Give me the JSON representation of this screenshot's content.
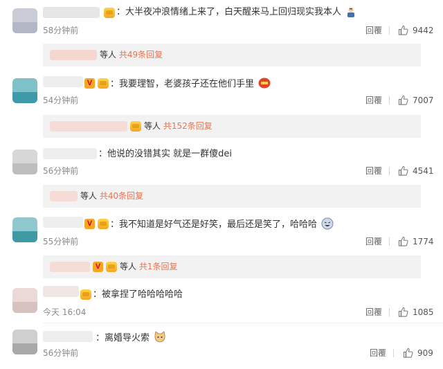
{
  "comments": [
    {
      "text": "大半夜冲浪情绪上来了，白天醒来马上回归现实我本人",
      "time": "58分钟前",
      "reply_label": "回覆",
      "likes": "9442",
      "sub_prefix": "等人",
      "sub_count": "共49条回复",
      "emoji": "person-facepalm-icon"
    },
    {
      "text": "我要理智，老婆孩子还在他们手里",
      "time": "54分钟前",
      "reply_label": "回覆",
      "likes": "7007",
      "sub_prefix": "等人",
      "sub_count": "共152条回复",
      "emoji": "red-envelope-icon"
    },
    {
      "text": "他说的没错其实 就是一群傻dei",
      "time": "56分钟前",
      "reply_label": "回覆",
      "likes": "4541",
      "sub_prefix": "等人",
      "sub_count": "共40条回复"
    },
    {
      "text": "我不知道是好气还是好笑，最后还是笑了，哈哈哈",
      "time": "55分钟前",
      "reply_label": "回覆",
      "likes": "1774",
      "sub_prefix": "等人",
      "sub_count": "共1条回复",
      "emoji": "laughing-face-icon"
    },
    {
      "text": "被拿捏了哈哈哈哈哈",
      "time": "今天 16:04",
      "reply_label": "回覆",
      "likes": "1085"
    },
    {
      "text": "离婚导火索",
      "time": "56分钟前",
      "reply_label": "回覆",
      "likes": "909",
      "emoji": "cat-face-icon"
    }
  ],
  "colors": {
    "link_orange": "#eb7350",
    "subreply_bg": "#f2f2f2",
    "vip_badge": "#f6a623"
  },
  "badges": {
    "verified_v": "V"
  }
}
